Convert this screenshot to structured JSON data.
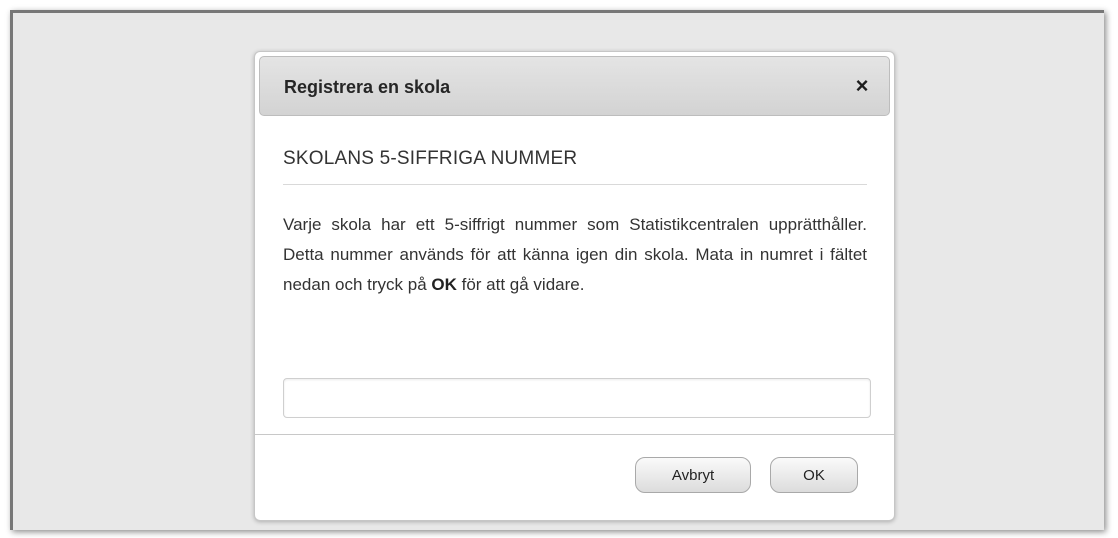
{
  "dialog": {
    "title": "Registrera en skola",
    "close_icon": "×",
    "section_heading": "SKOLANS 5-SIFFRIGA NUMMER",
    "description_part1": "Varje skola har ett 5-siffrigt nummer som Statistikcentralen upprätthåller. Detta nummer används för att känna igen din skola. Mata in numret i fältet nedan och tryck på ",
    "description_bold": "OK",
    "description_part2": " för att gå vidare.",
    "input": {
      "value": "",
      "placeholder": ""
    },
    "cancel_label": "Avbryt",
    "ok_label": "OK"
  },
  "colors": {
    "background": "#e8e8e8",
    "header_gradient_top": "#e4e4e4",
    "header_gradient_bottom": "#d3d3d3",
    "text": "#333333"
  }
}
